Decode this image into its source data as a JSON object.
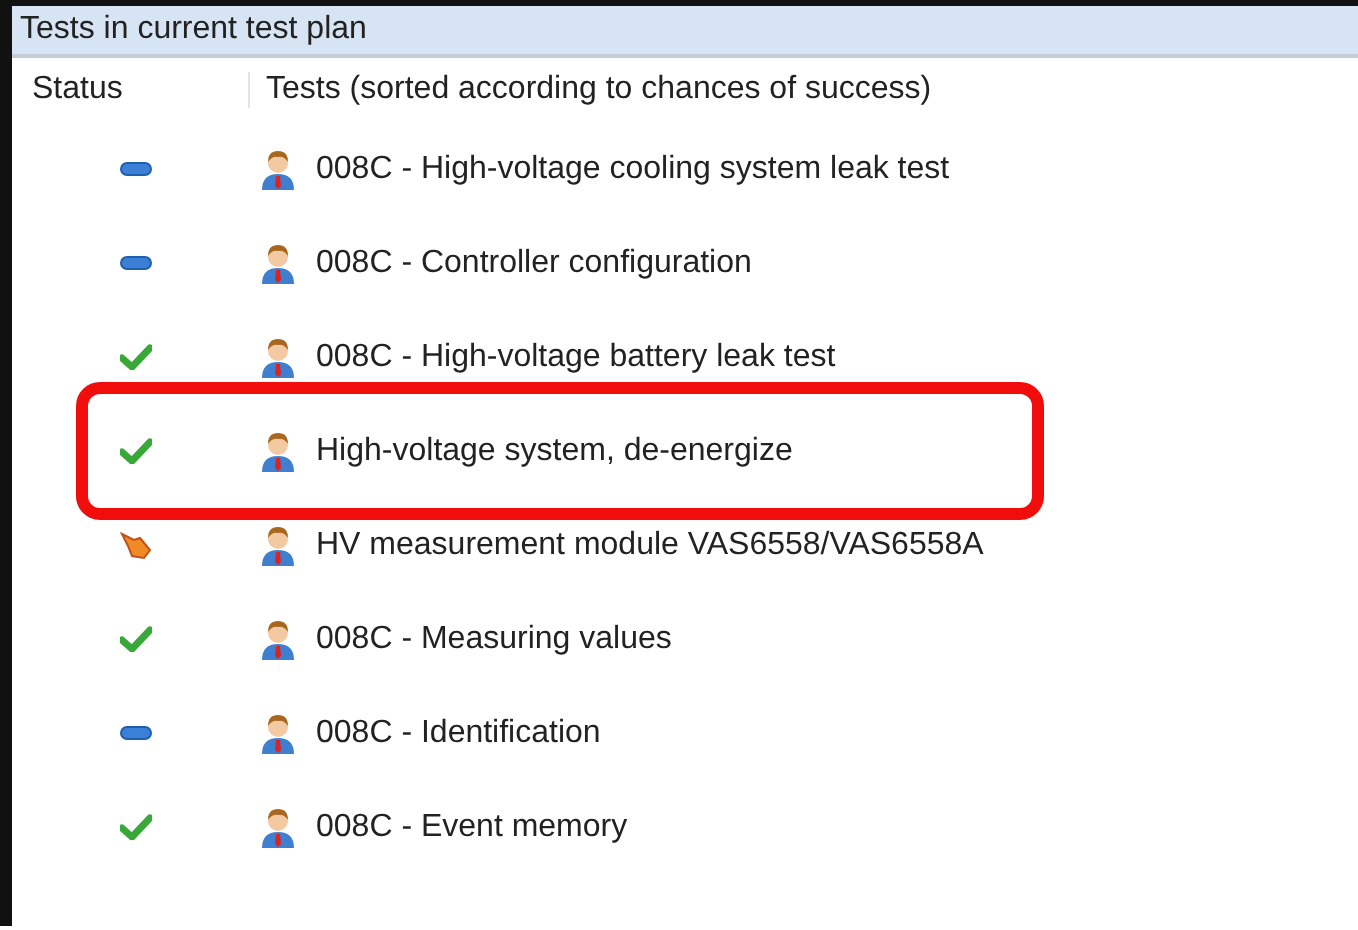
{
  "panel": {
    "title": "Tests in current test plan"
  },
  "table": {
    "columns": [
      "Status",
      "Tests (sorted according to chances of success)"
    ],
    "rows": [
      {
        "kind": "pending",
        "label": "008C - High-voltage cooling system leak test",
        "highlighted": false
      },
      {
        "kind": "pending",
        "label": "008C - Controller configuration",
        "highlighted": false
      },
      {
        "kind": "passed",
        "label": "008C - High-voltage battery leak test",
        "highlighted": false
      },
      {
        "kind": "passed",
        "label": "High-voltage system, de-energize",
        "highlighted": true
      },
      {
        "kind": "pointer",
        "label": "HV measurement module VAS6558/VAS6558A",
        "highlighted": false
      },
      {
        "kind": "passed",
        "label": "008C - Measuring values",
        "highlighted": false
      },
      {
        "kind": "pending",
        "label": "008C - Identification",
        "highlighted": false
      },
      {
        "kind": "passed",
        "label": "008C - Event memory",
        "highlighted": false
      }
    ]
  }
}
